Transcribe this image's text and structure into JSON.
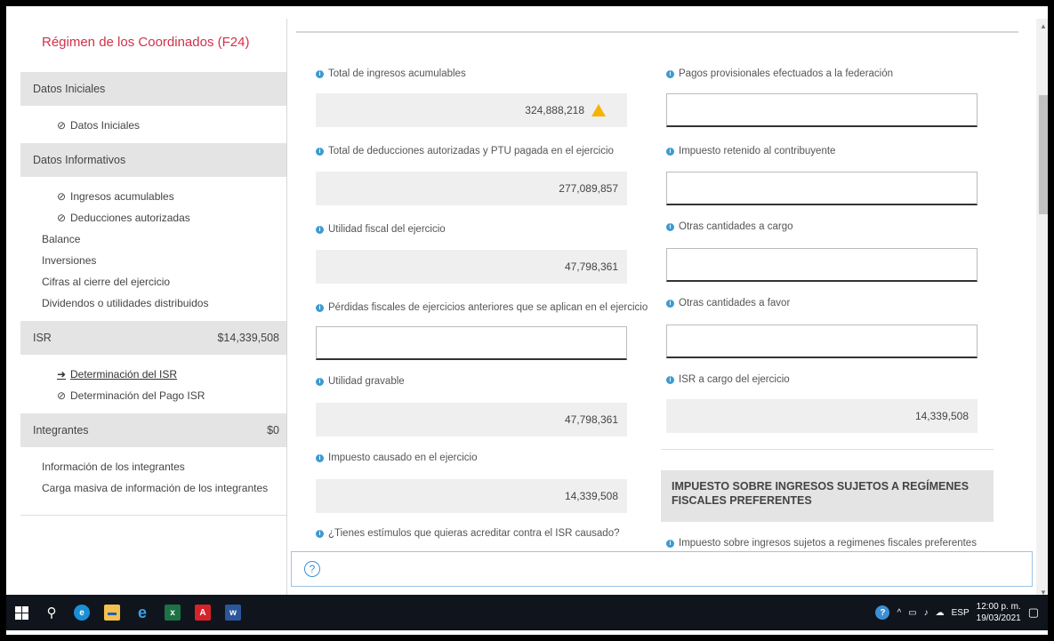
{
  "sidebar": {
    "title": "Régimen de los Coordinados (F24)",
    "sections": [
      {
        "label": "Datos Iniciales",
        "amount": "",
        "items": [
          {
            "label": "Datos Iniciales",
            "icon": "check-circle-icon"
          }
        ]
      },
      {
        "label": "Datos Informativos",
        "amount": "",
        "items": [
          {
            "label": "Ingresos acumulables",
            "icon": "check-circle-icon"
          },
          {
            "label": "Deducciones autorizadas",
            "icon": "check-circle-icon"
          },
          {
            "label": "Balance",
            "icon": ""
          },
          {
            "label": "Inversiones",
            "icon": ""
          },
          {
            "label": "Cifras al cierre del ejercicio",
            "icon": ""
          },
          {
            "label": "Dividendos o utilidades distribuidos",
            "icon": ""
          }
        ]
      },
      {
        "label": "ISR",
        "amount": "$14,339,508",
        "items": [
          {
            "label": "Determinación del ISR",
            "icon": "arrow-right-icon"
          },
          {
            "label": "Determinación del Pago ISR",
            "icon": "check-circle-icon"
          }
        ]
      },
      {
        "label": "Integrantes",
        "amount": "$0",
        "items": [
          {
            "label": "Información de los integrantes",
            "icon": ""
          },
          {
            "label": "Carga masiva de información de los integrantes",
            "icon": ""
          }
        ]
      }
    ]
  },
  "form": {
    "left": [
      {
        "label": "Total de ingresos acumulables",
        "value": "324,888,218",
        "warning": true
      },
      {
        "label": "Total de deducciones autorizadas y PTU pagada en el ejercicio",
        "value": "277,089,857"
      },
      {
        "label": "Utilidad fiscal del ejercicio",
        "value": "47,798,361"
      },
      {
        "label": "Pérdidas fiscales de ejercicios anteriores que se aplican en el ejercicio",
        "value": ""
      },
      {
        "label": "Utilidad gravable",
        "value": "47,798,361"
      },
      {
        "label": "Impuesto causado en el ejercicio",
        "value": "14,339,508"
      },
      {
        "label": "¿Tienes estímulos que quieras acreditar contra el ISR causado?",
        "value": ""
      }
    ],
    "right": [
      {
        "label": "Pagos provisionales efectuados a la federación",
        "value": ""
      },
      {
        "label": "Impuesto retenido al contribuyente",
        "value": ""
      },
      {
        "label": "Otras cantidades a cargo",
        "value": ""
      },
      {
        "label": "Otras cantidades a favor",
        "value": ""
      },
      {
        "label": "ISR a cargo del ejercicio",
        "value": "14,339,508"
      }
    ],
    "section_title": "IMPUESTO SOBRE INGRESOS SUJETOS A REGÍMENES FISCALES PREFERENTES",
    "section_field_label": "Impuesto sobre ingresos sujetos a regimenes fiscales preferentes"
  },
  "help": {
    "icon": "help-icon"
  },
  "taskbar": {
    "apps": [
      "windows-start-icon",
      "search-icon",
      "edge-icon",
      "file-explorer-icon",
      "internet-explorer-icon",
      "excel-icon",
      "acrobat-icon",
      "word-icon"
    ],
    "tray": {
      "language": "ESP",
      "time": "12:00 p. m.",
      "date": "19/03/2021"
    }
  },
  "colors": {
    "accent_red": "#d2314a",
    "info_blue": "#3d9ad1",
    "warning": "#f4b400"
  }
}
